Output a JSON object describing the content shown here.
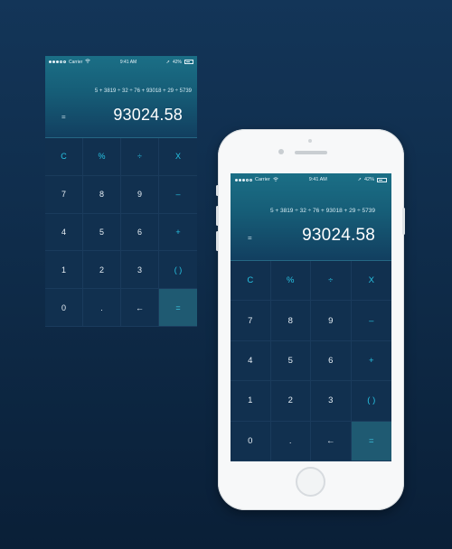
{
  "status": {
    "carrier": "Carrier",
    "time": "9:41 AM",
    "battery": "42%"
  },
  "display": {
    "expression": "5 + 3819 ÷ 32 ÷ 76 + 93018 + 29 ÷ 5739",
    "equals_sign": "=",
    "result": "93024.58"
  },
  "keys": [
    {
      "label": "C",
      "type": "op"
    },
    {
      "label": "%",
      "type": "op"
    },
    {
      "label": "÷",
      "type": "op"
    },
    {
      "label": "X",
      "type": "op"
    },
    {
      "label": "7",
      "type": "num"
    },
    {
      "label": "8",
      "type": "num"
    },
    {
      "label": "9",
      "type": "num"
    },
    {
      "label": "–",
      "type": "op"
    },
    {
      "label": "4",
      "type": "num"
    },
    {
      "label": "5",
      "type": "num"
    },
    {
      "label": "6",
      "type": "num"
    },
    {
      "label": "+",
      "type": "op"
    },
    {
      "label": "1",
      "type": "num"
    },
    {
      "label": "2",
      "type": "num"
    },
    {
      "label": "3",
      "type": "num"
    },
    {
      "label": "( )",
      "type": "op"
    },
    {
      "label": "0",
      "type": "num"
    },
    {
      "label": ".",
      "type": "num"
    },
    {
      "label": "←",
      "type": "num"
    },
    {
      "label": "=",
      "type": "eq"
    }
  ],
  "colors": {
    "accent": "#27c3e3",
    "background": "#0e2a47",
    "equals_key": "#1f5a72"
  }
}
